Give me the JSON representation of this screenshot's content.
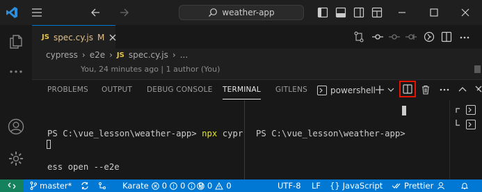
{
  "titlebar": {
    "search_text": "weather-app"
  },
  "editor": {
    "tab": {
      "icon_text": "JS",
      "filename": "spec.cy.js",
      "modified_marker": "M"
    },
    "breadcrumb": {
      "segments": [
        "cypress",
        "e2e"
      ],
      "file_icon_text": "JS",
      "file": "spec.cy.js",
      "more": "..."
    },
    "blame": "You, 24 minutes ago | 1 author (You)"
  },
  "panel": {
    "tabs": [
      "PROBLEMS",
      "OUTPUT",
      "DEBUG CONSOLE",
      "TERMINAL",
      "GITLENS"
    ],
    "active_tab": "TERMINAL",
    "shell_label": "powershell"
  },
  "terminal": {
    "left": {
      "prompt": "PS C:\\vue_lesson\\weather-app> ",
      "command": "npx",
      "args_line1": " cypr",
      "args_line2": "ess open --e2e"
    },
    "right": {
      "prompt": "PS C:\\vue_lesson\\weather-app> "
    }
  },
  "statusbar": {
    "branch": "master*",
    "karate": "Karate",
    "karate_errors": "0",
    "karate_warnings": "0",
    "karate_info": "0",
    "errors": "0",
    "warnings": "0",
    "encoding": "UTF-8",
    "eol": "LF",
    "language": "JavaScript",
    "formatter": "Prettier"
  },
  "colors": {
    "accent": "#0078d4",
    "highlight_box": "#e51400",
    "js_icon": "#e8c441",
    "modified": "#e2c08d",
    "command": "#e5e510"
  }
}
